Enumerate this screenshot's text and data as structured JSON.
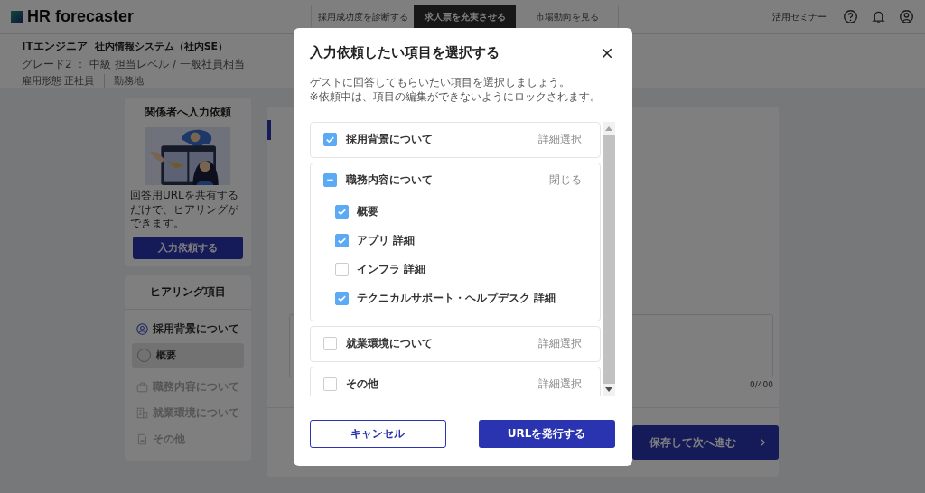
{
  "header": {
    "logo": "HR forecaster",
    "tabs": [
      {
        "label": "採用成功度を診断する",
        "selected": false
      },
      {
        "label": "求人票を充実させる",
        "selected": true
      },
      {
        "label": "市場動向を見る",
        "selected": false
      }
    ],
    "seminar_link": "活用セミナー"
  },
  "job": {
    "title": "ITエンジニア",
    "category": "社内情報システム（社内SE）",
    "details": [
      "グレード2 ： 中級 担当レベル / 一般社員相当",
      "雇用形態 正社員",
      "勤務地"
    ]
  },
  "request_card": {
    "title": "関係者へ入力依頼",
    "text": "回答用URLを共有するだけで、ヒアリングができます。",
    "button": "入力依頼する"
  },
  "hearing": {
    "title": "ヒアリング項目",
    "sections": [
      {
        "label": "採用背景について",
        "active": true,
        "children": [
          {
            "label": "概要",
            "selected": true
          }
        ]
      },
      {
        "label": "職務内容について",
        "active": false
      },
      {
        "label": "就業環境について",
        "active": false
      },
      {
        "label": "その他",
        "active": false
      }
    ]
  },
  "main": {
    "counter": "0/400",
    "next_button": "保存して次へ進む"
  },
  "modal": {
    "title": "入力依頼したい項目を選択する",
    "description": [
      "ゲストに回答してもらいたい項目を選択しましょう。",
      "※依頼中は、項目の編集ができないようにロックされます。"
    ],
    "groups": [
      {
        "label": "採用背景について",
        "checked": true,
        "action": "詳細選択",
        "expanded": false
      },
      {
        "label": "職務内容について",
        "partial": true,
        "action": "閉じる",
        "expanded": true,
        "children": [
          {
            "label": "概要",
            "checked": true
          },
          {
            "label": "アプリ 詳細",
            "checked": true
          },
          {
            "label": "インフラ 詳細",
            "checked": false
          },
          {
            "label": "テクニカルサポート・ヘルプデスク 詳細",
            "checked": true
          }
        ]
      },
      {
        "label": "就業環境について",
        "checked": false,
        "action": "詳細選択",
        "expanded": false
      },
      {
        "label": "その他",
        "checked": false,
        "action": "詳細選択",
        "expanded": false
      }
    ],
    "cancel": "キャンセル",
    "submit": "URLを発行する"
  }
}
